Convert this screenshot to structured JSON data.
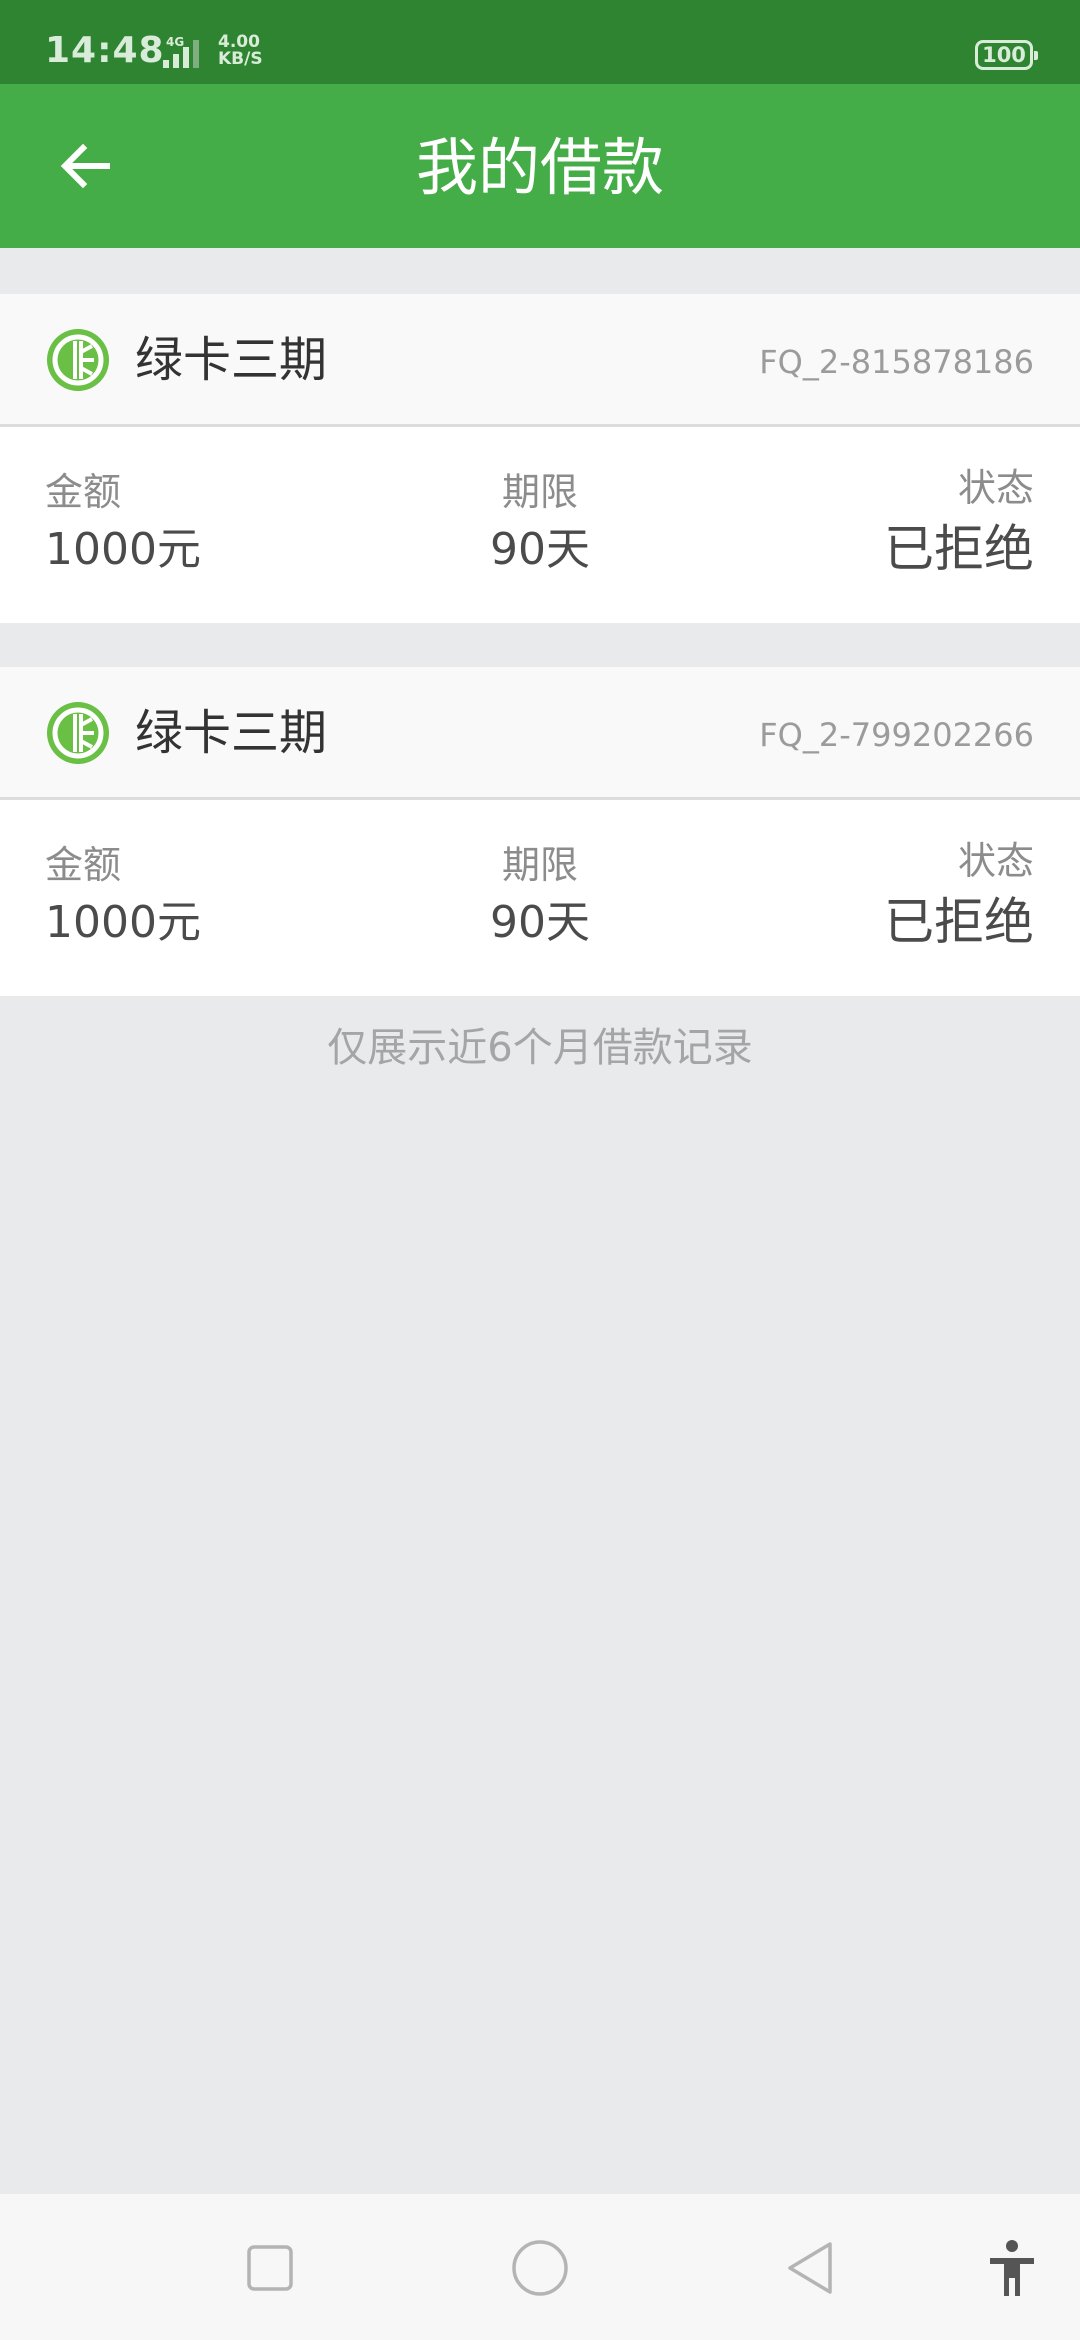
{
  "status_bar": {
    "time": "14:48",
    "network_type": "4G",
    "speed_value": "4.00",
    "speed_unit": "KB/S",
    "battery": "100"
  },
  "app_bar": {
    "title": "我的借款",
    "back_icon": "arrow-left-icon"
  },
  "colors": {
    "status_bar": "#2e8431",
    "app_bar": "#45ad47",
    "page_bg": "#e9eaec",
    "logo_green": "#6abf45"
  },
  "loans": [
    {
      "product_name": "绿卡三期",
      "order_no": "FQ_2-815878186",
      "amount_label": "金额",
      "amount_value": "1000元",
      "term_label": "期限",
      "term_value": "90天",
      "status_label": "状态",
      "status_value": "已拒绝"
    },
    {
      "product_name": "绿卡三期",
      "order_no": "FQ_2-799202266",
      "amount_label": "金额",
      "amount_value": "1000元",
      "term_label": "期限",
      "term_value": "90天",
      "status_label": "状态",
      "status_value": "已拒绝"
    }
  ],
  "footnote": "仅展示近6个月借款记录",
  "nav_bar": {
    "icons": [
      "recent-apps-icon",
      "home-icon",
      "back-triangle-icon",
      "accessibility-icon"
    ]
  }
}
